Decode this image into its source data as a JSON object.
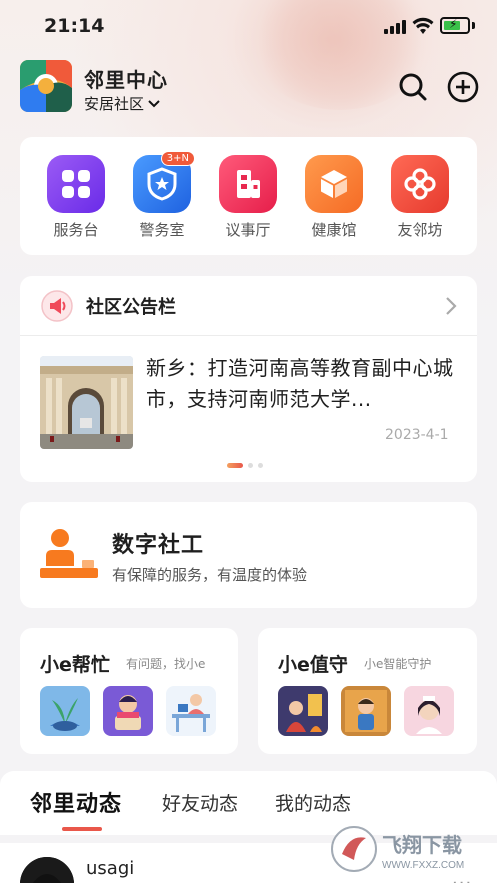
{
  "status": {
    "time": "21:14"
  },
  "header": {
    "title": "邻里中心",
    "community": "安居社区",
    "icons": {
      "search": "search-icon",
      "add": "add-circle-icon"
    }
  },
  "services": [
    {
      "label": "服务台",
      "icon": "grid-icon",
      "color": "#7b3df1"
    },
    {
      "label": "警务室",
      "icon": "police-shield-icon",
      "color": "#2f7cf0",
      "badge": "3+N"
    },
    {
      "label": "议事厅",
      "icon": "building-icon",
      "color": "#f0325a"
    },
    {
      "label": "健康馆",
      "icon": "box-icon",
      "color": "#fb7d35"
    },
    {
      "label": "友邻坊",
      "icon": "flower-icon",
      "color": "#f04a3c"
    }
  ],
  "notice": {
    "title": "社区公告栏",
    "news_title": "新乡：打造河南高等教育副中心城市，支持河南师范大学...",
    "news_date": "2023-4-1"
  },
  "social_work": {
    "title": "数字社工",
    "subtitle": "有保障的服务，有温度的体验"
  },
  "help": {
    "title": "小e帮忙",
    "subtitle": "有问题，找小e"
  },
  "guard": {
    "title": "小e值守",
    "subtitle": "小e智能守护"
  },
  "tabs": [
    {
      "label": "邻里动态",
      "active": true
    },
    {
      "label": "好友动态",
      "active": false
    },
    {
      "label": "我的动态",
      "active": false
    }
  ],
  "feed": {
    "username": "usagi",
    "more": "..."
  },
  "watermark": {
    "text": "飞翔下载",
    "url": "WWW.FXXZ.COM"
  },
  "colors": {
    "accent": "#e9574a",
    "background": "#f4f3f5"
  }
}
